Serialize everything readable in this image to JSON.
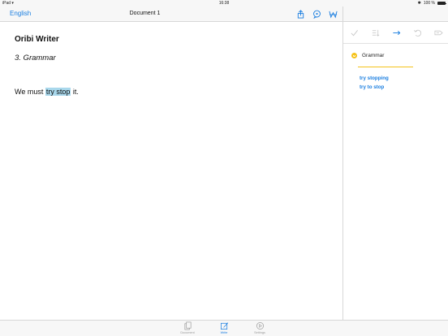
{
  "status_bar": {
    "device": "iPad",
    "time": "16:38",
    "battery": "100 %"
  },
  "navbar": {
    "language": "English",
    "document_title": "Document 1"
  },
  "document": {
    "heading": "Oribi Writer",
    "subheading": "3. Grammar",
    "sentence_before": "We must ",
    "highlighted": "try stop",
    "sentence_after": " it."
  },
  "sidebar": {
    "issue_label": "Grammar",
    "suggestions": [
      "try stopping",
      "try to stop"
    ]
  },
  "tabs": [
    {
      "label": "Document",
      "icon": "document-icon",
      "active": false
    },
    {
      "label": "Write",
      "icon": "write-icon",
      "active": true
    },
    {
      "label": "Settings",
      "icon": "settings-icon",
      "active": false
    }
  ],
  "colors": {
    "accent": "#1a7ee0",
    "highlight": "#a9d8ec",
    "grammar": "#f5c21a"
  }
}
